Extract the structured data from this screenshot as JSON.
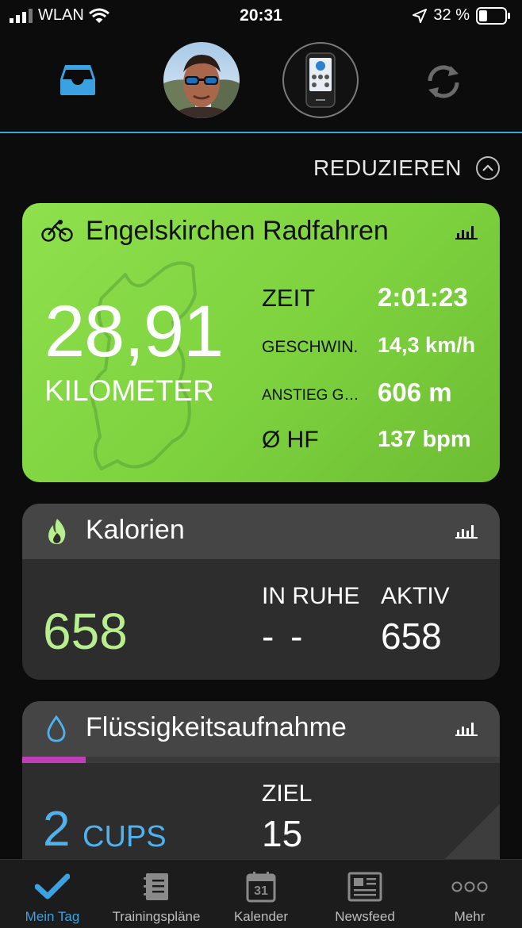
{
  "status_bar": {
    "carrier": "WLAN",
    "time": "20:31",
    "battery": "32 %",
    "battery_level": 0.32
  },
  "header": {
    "icons": [
      "inbox-icon",
      "avatar",
      "device-icon",
      "sync-icon"
    ]
  },
  "reduce_label": "REDUZIEREN",
  "activity": {
    "title": "Engelskirchen Radfahren",
    "distance": "28,91",
    "distance_unit": "KILOMETER",
    "stats": [
      {
        "label": "ZEIT",
        "value": "2:01:23"
      },
      {
        "label": "GESCHWIN.",
        "value": "14,3 km/h"
      },
      {
        "label": "ANSTIEG G…",
        "value": "606 m"
      },
      {
        "label": "Ø HF",
        "value": "137 bpm"
      }
    ],
    "color": "#7dd23e"
  },
  "calories": {
    "title": "Kalorien",
    "total": "658",
    "rest_label": "IN RUHE",
    "rest_value": "- -",
    "active_label": "AKTIV",
    "active_value": "658",
    "color": "#b7ef8e"
  },
  "hydration": {
    "title": "Flüssigkeitsaufnahme",
    "amount": "2",
    "unit": "CUPS",
    "goal_label": "ZIEL",
    "goal_value": "15",
    "progress": 0.133,
    "progress_color": "#c03fb6",
    "accent": "#4fb2ef"
  },
  "tabbar": {
    "items": [
      {
        "label": "Mein Tag",
        "active": true
      },
      {
        "label": "Trainingspläne"
      },
      {
        "label": "Kalender",
        "calendar_day": "31"
      },
      {
        "label": "Newsfeed"
      },
      {
        "label": "Mehr"
      }
    ],
    "active_color": "#3aa2e0"
  }
}
